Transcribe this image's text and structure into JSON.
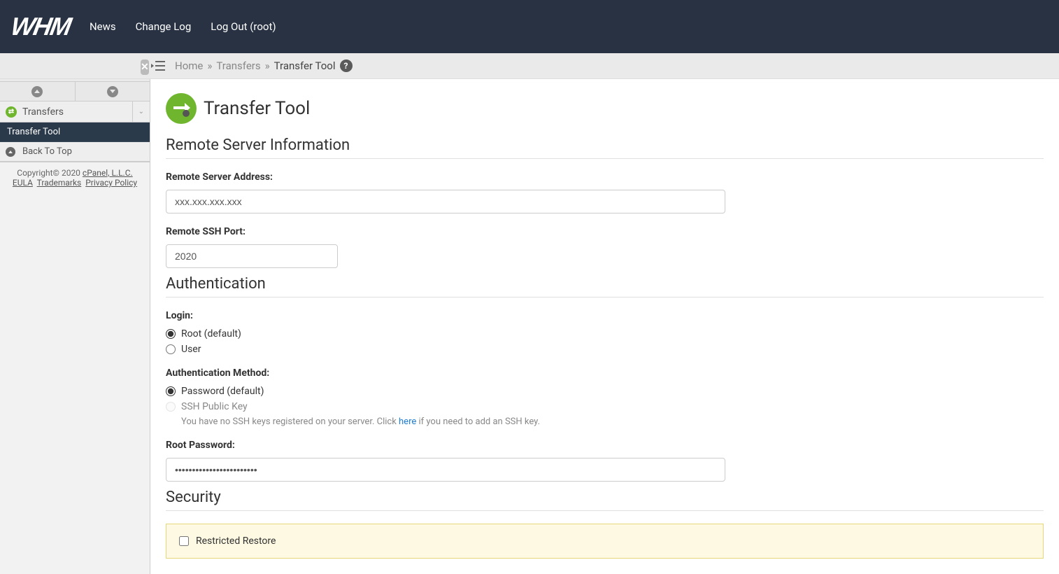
{
  "topnav": {
    "logo_text": "WHM",
    "links": {
      "news": "News",
      "change_log": "Change Log",
      "logout": "Log Out (root)"
    }
  },
  "sidebar": {
    "search_value": "Transfer Tool",
    "section_label": "Transfers",
    "item_label": "Transfer Tool",
    "back_label": "Back To Top",
    "footer": {
      "copyright": "Copyright© 2020 ",
      "cpanel": "cPanel, L.L.C.",
      "eula": "EULA",
      "trademarks": "Trademarks",
      "privacy": "Privacy Policy"
    }
  },
  "breadcrumb": {
    "home": "Home",
    "transfers": "Transfers",
    "current": "Transfer Tool"
  },
  "page": {
    "title": "Transfer Tool",
    "sections": {
      "remote_info": "Remote Server Information",
      "auth": "Authentication",
      "security": "Security"
    },
    "fields": {
      "remote_address_label": "Remote Server Address:",
      "remote_address_value": "xxx.xxx.xxx.xxx",
      "ssh_port_label": "Remote SSH Port:",
      "ssh_port_value": "2020",
      "login_label": "Login:",
      "login_root": "Root (default)",
      "login_user": "User",
      "auth_method_label": "Authentication Method:",
      "auth_password": "Password (default)",
      "auth_ssh_key": "SSH Public Key",
      "ssh_hint_prefix": "You have no SSH keys registered on your server. Click ",
      "ssh_hint_link": "here",
      "ssh_hint_suffix": " if you need to add an SSH key.",
      "root_password_label": "Root Password:",
      "root_password_value": "••••••••••••••••••••••••",
      "restricted_restore": "Restricted Restore"
    }
  }
}
